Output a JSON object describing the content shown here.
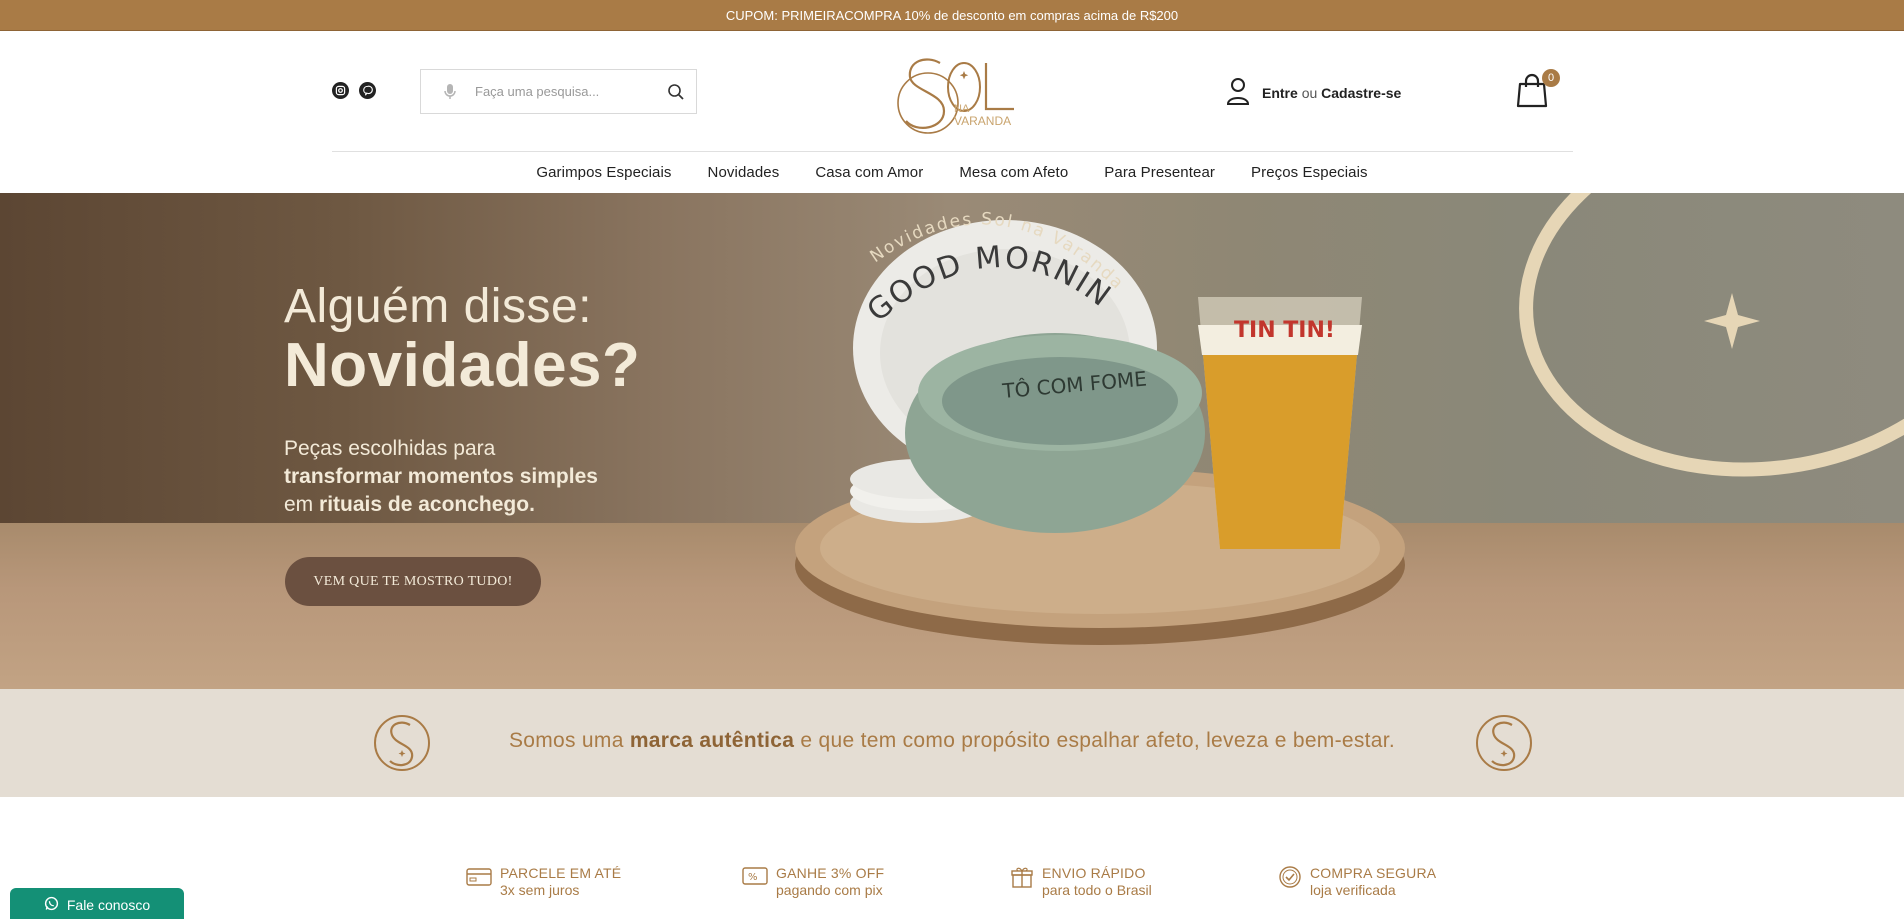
{
  "topbar": {
    "text": "CUPOM: PRIMEIRACOMPRA 10% de desconto em compras acima de R$200"
  },
  "header": {
    "search_placeholder": "Faça uma pesquisa...",
    "account_entre": "Entre",
    "account_ou": "ou",
    "account_cadastre": "Cadastre-se",
    "cart_count": "0",
    "social_icons": [
      "instagram-icon",
      "pinterest-icon"
    ]
  },
  "nav": {
    "items": [
      {
        "label": "Garimpos Especiais"
      },
      {
        "label": "Novidades"
      },
      {
        "label": "Casa com Amor"
      },
      {
        "label": "Mesa com Afeto"
      },
      {
        "label": "Para Presentear"
      },
      {
        "label": "Preços Especiais"
      }
    ]
  },
  "hero": {
    "line1": "Alguém disse:",
    "line2": "Novidades?",
    "sub_a": "Peças escolhidas para",
    "sub_b": "transformar momentos simples",
    "sub_c_pre": "em",
    "sub_c_bold": "rituais de aconchego.",
    "button": "VEM QUE TE MOSTRO TUDO!",
    "arc_text": "Novidades Sol na Varanda",
    "plate_text": "GOOD MORNING",
    "bowl_text": "TÔ COM FOME",
    "glass_text": "TIN TIN!"
  },
  "brandbar": {
    "msg_pre": "Somos uma",
    "msg_bold": "marca autêntica",
    "msg_post": "e que tem como propósito espalhar afeto, leveza e bem-estar."
  },
  "benefits": [
    {
      "title": "PARCELE EM ATÉ",
      "sub": "3x sem juros",
      "icon": "card-icon"
    },
    {
      "title": "GANHE 3% OFF",
      "sub": "pagando com pix",
      "icon": "discount-icon"
    },
    {
      "title": "ENVIO RÁPIDO",
      "sub": "para todo o Brasil",
      "icon": "gift-icon"
    },
    {
      "title": "COMPRA SEGURA",
      "sub": "loja verificada",
      "icon": "shield-check-icon"
    }
  ],
  "whatsapp": {
    "label": "Fale conosco"
  },
  "colors": {
    "brand": "#a97b46",
    "beige": "#e4ddd3",
    "whatsapp": "#149076",
    "cream": "#f3ead8"
  }
}
